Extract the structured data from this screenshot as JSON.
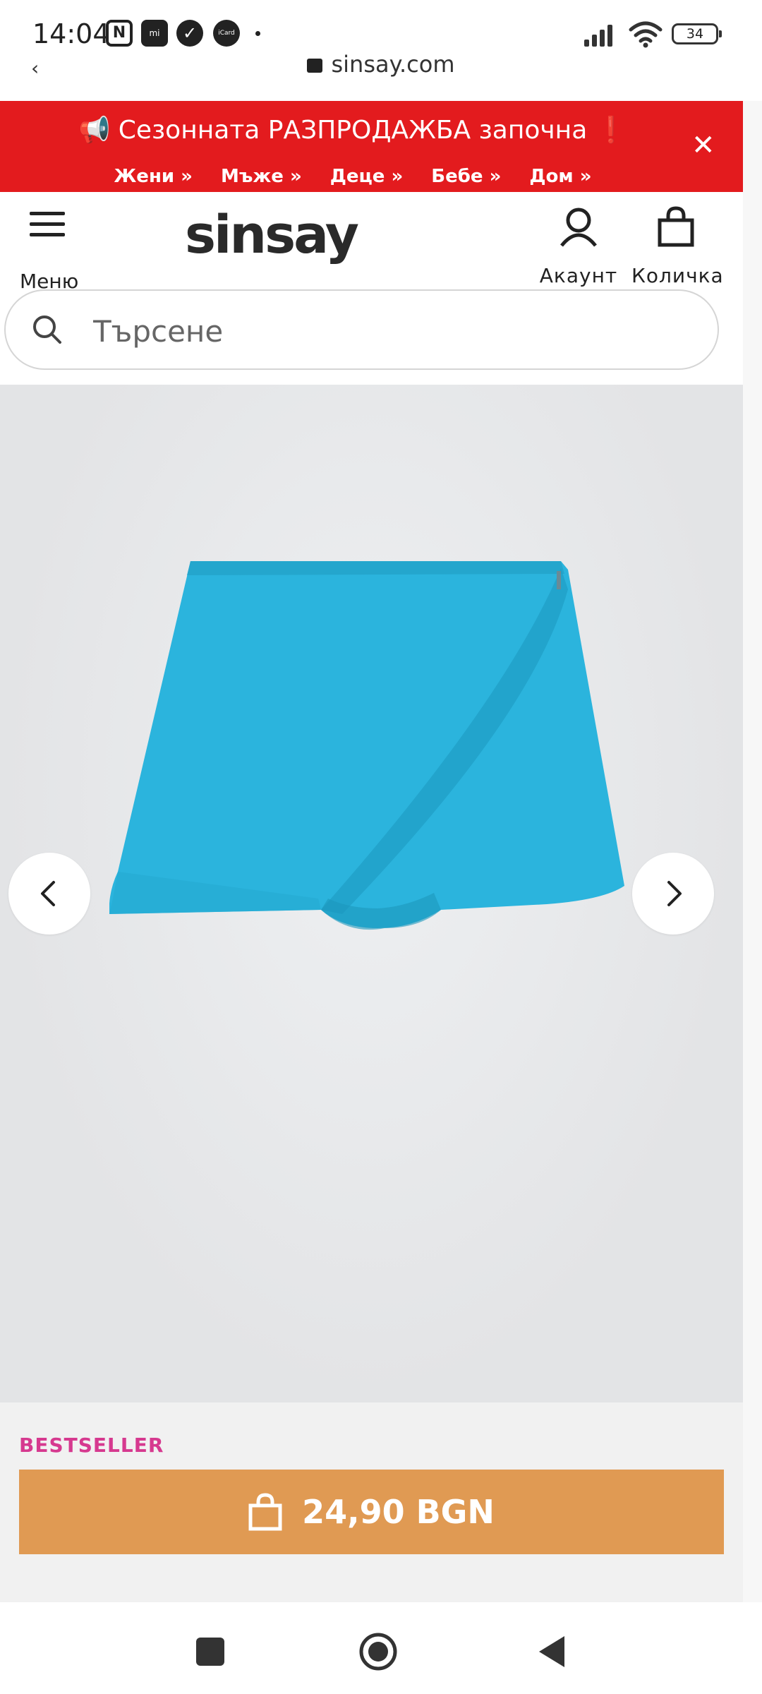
{
  "status_bar": {
    "time": "14:04",
    "icons": [
      "nfc-icon",
      "mi-icon",
      "check-icon",
      "icard-icon"
    ],
    "mi_text": "mi",
    "icard_text": "iCard",
    "battery": "34"
  },
  "browser": {
    "url": "sinsay.com"
  },
  "promo": {
    "title": "Сезонната РАЗПРОДАЖБА започна",
    "links": [
      "Жени »",
      "Мъже »",
      "Деце »",
      "Бебе »",
      "Дом »"
    ],
    "background": "#e31b1e"
  },
  "header": {
    "logo": "sinsay",
    "menu_label": "Меню",
    "account_label": "Акаунт",
    "cart_label": "Количка"
  },
  "search": {
    "placeholder": "Търсене",
    "value": ""
  },
  "product": {
    "color": "#2bb4dd",
    "badge": "BESTSELLER",
    "price": "24,90 BGN",
    "badge_color": "#d6398f",
    "button_color": "#e09a53"
  }
}
